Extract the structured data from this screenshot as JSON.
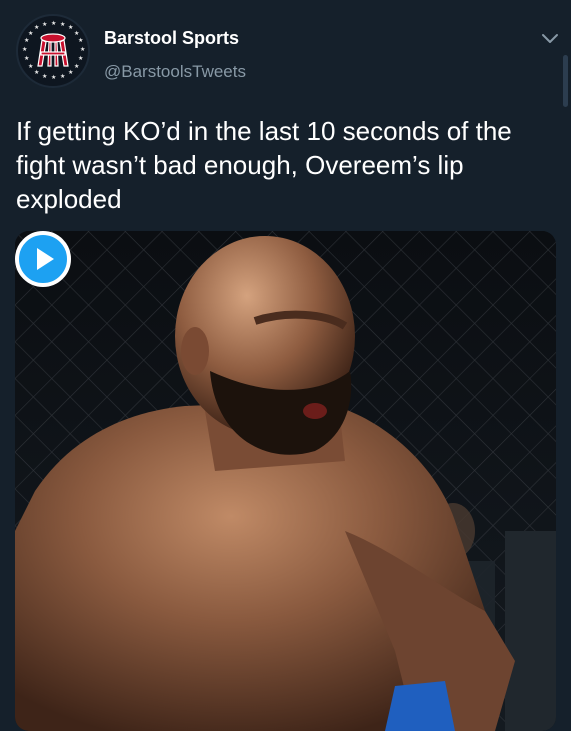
{
  "tweet": {
    "display_name": "Barstool Sports",
    "handle": "@BarstoolsTweets",
    "text": "If getting KO’d in the last 10 seconds of the fight wasn’t bad enough, Overeem’s lip exploded"
  },
  "icons": {
    "avatar": "barstool-logo-icon",
    "menu": "chevron-down-icon",
    "play": "play-icon"
  },
  "colors": {
    "background": "#15202b",
    "secondary_text": "#8899a6",
    "accent": "#1da1f2",
    "logo_red": "#c8102e"
  }
}
